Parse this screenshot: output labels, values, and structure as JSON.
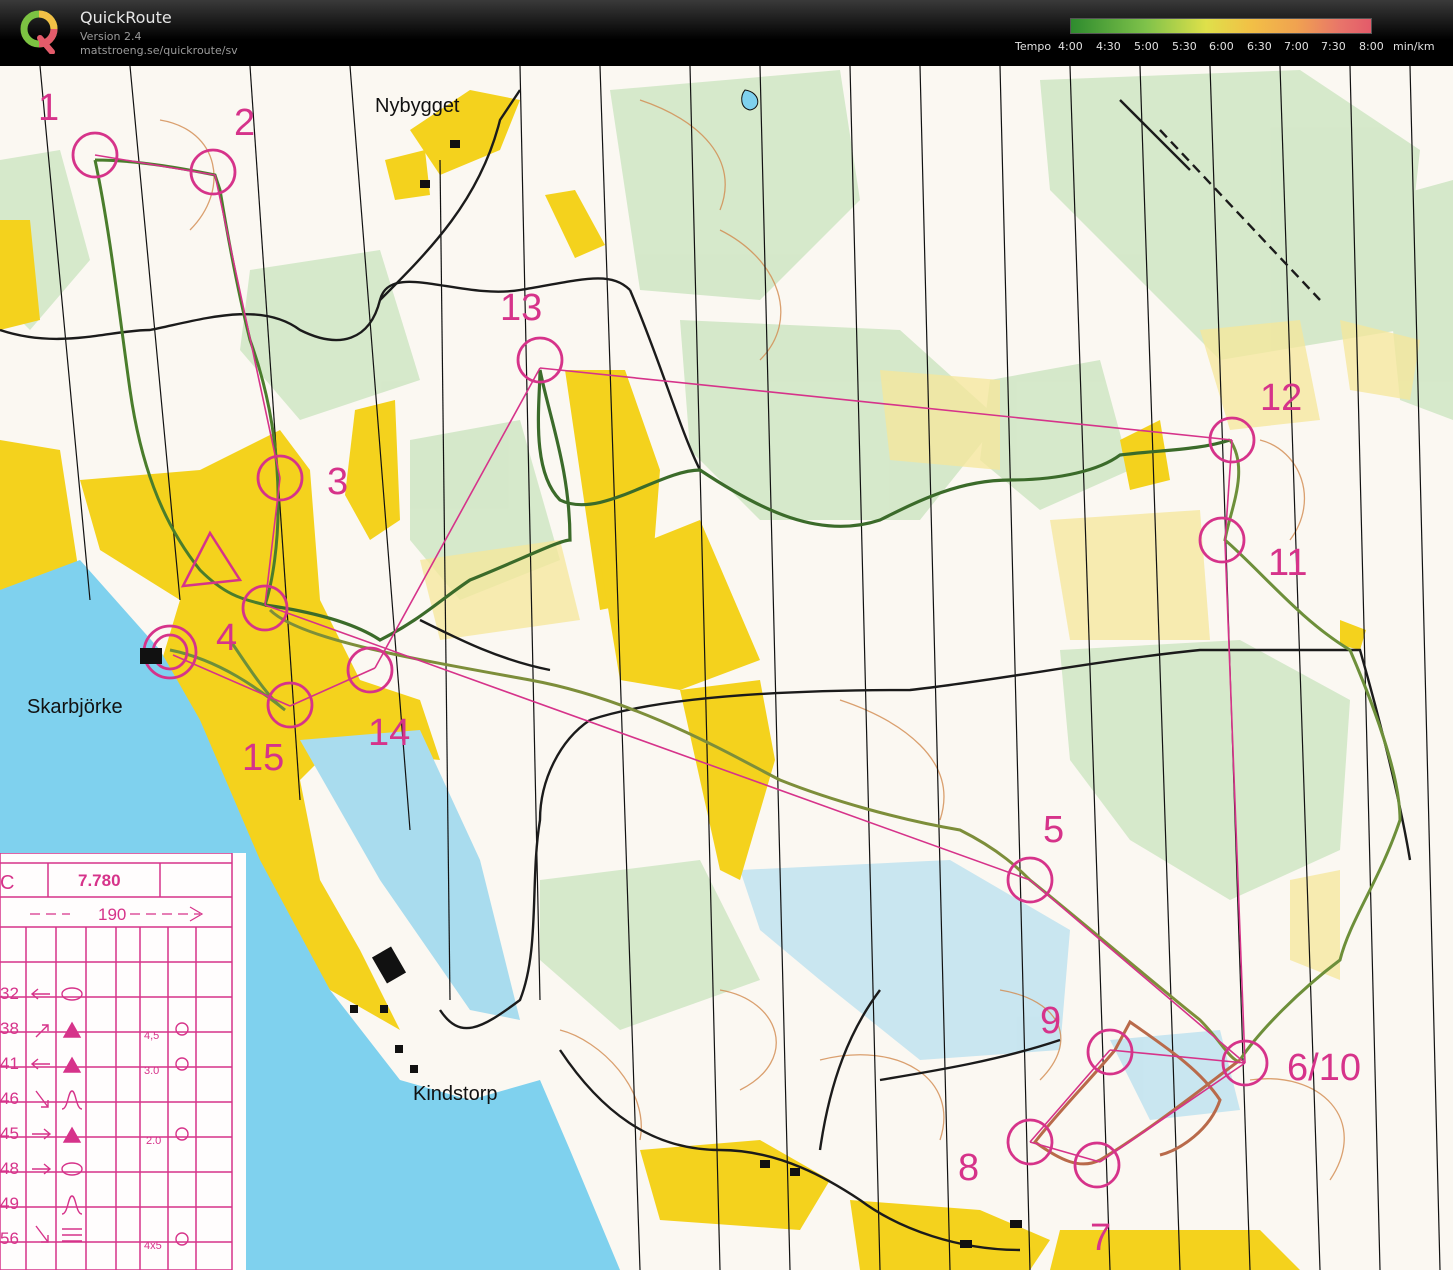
{
  "header": {
    "app_name": "QuickRoute",
    "version": "Version 2.4",
    "url": "matstroeng.se/quickroute/sv",
    "logo_letter": "Q"
  },
  "legend": {
    "label": "Tempo",
    "ticks": [
      "4:00",
      "4:30",
      "5:00",
      "5:30",
      "6:00",
      "6:30",
      "7:00",
      "7:30",
      "8:00"
    ],
    "unit": "min/km",
    "colors": [
      "#2e8b2e",
      "#7fc24a",
      "#dfe04a",
      "#f2c046",
      "#f0a350",
      "#e8746a",
      "#e35b6a"
    ]
  },
  "map": {
    "course_color": "#d6338a",
    "route_color": "#3b6b2a",
    "controls": [
      {
        "label": "1"
      },
      {
        "label": "2"
      },
      {
        "label": "3"
      },
      {
        "label": "4"
      },
      {
        "label": "5"
      },
      {
        "label": "6/10"
      },
      {
        "label": "7"
      },
      {
        "label": "8"
      },
      {
        "label": "9"
      },
      {
        "label": "11"
      },
      {
        "label": "12"
      },
      {
        "label": "13"
      },
      {
        "label": "14"
      },
      {
        "label": "15"
      }
    ],
    "place_names": [
      "Nybygget",
      "Skarbjörke",
      "Kindstorp"
    ]
  },
  "description_sheet": {
    "course_code": "C",
    "length": "7.780",
    "climb": "190",
    "rows": [
      {
        "code": "32",
        "extra": ""
      },
      {
        "code": "38",
        "extra": "4,5"
      },
      {
        "code": "41",
        "extra": "3.0"
      },
      {
        "code": "46",
        "extra": ""
      },
      {
        "code": "45",
        "extra": "2.0"
      },
      {
        "code": "48",
        "extra": ""
      },
      {
        "code": "49",
        "extra": ""
      },
      {
        "code": "56",
        "extra": "4x5"
      }
    ]
  }
}
